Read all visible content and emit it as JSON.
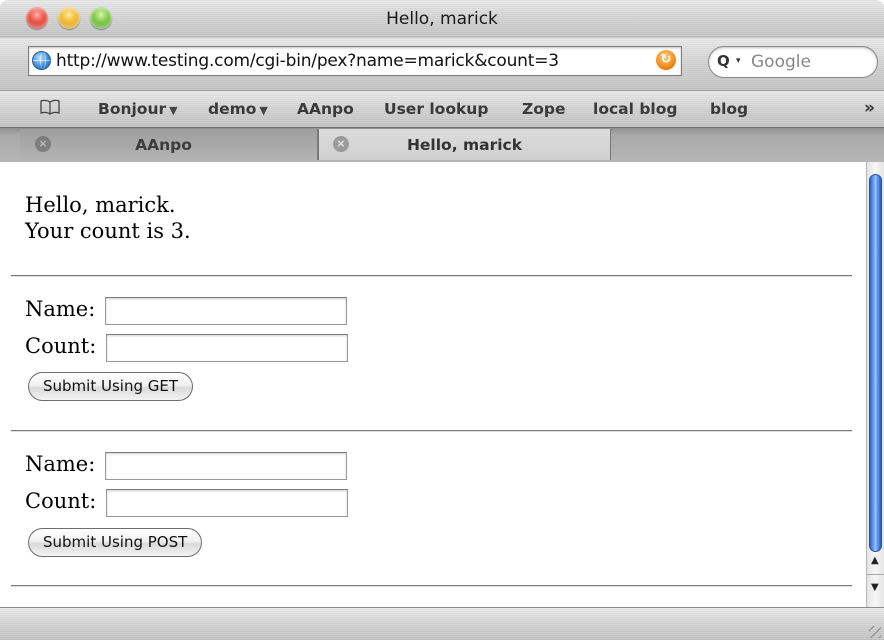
{
  "window": {
    "title": "Hello, marick"
  },
  "address_bar": {
    "url": "http://www.testing.com/cgi-bin/pex?name=marick&count=3",
    "search_placeholder": "Google"
  },
  "bookmarks": [
    {
      "label": "Bonjour",
      "has_menu": true
    },
    {
      "label": "demo",
      "has_menu": true
    },
    {
      "label": "AAnpo",
      "has_menu": false
    },
    {
      "label": "User lookup",
      "has_menu": false
    },
    {
      "label": "Zope",
      "has_menu": false
    },
    {
      "label": "local blog",
      "has_menu": false
    },
    {
      "label": "blog",
      "has_menu": false
    }
  ],
  "tabs": [
    {
      "label": "AAnpo",
      "active": false
    },
    {
      "label": "Hello, marick",
      "active": true
    }
  ],
  "page": {
    "greeting": "Hello, marick.",
    "count_line": "Your count is 3.",
    "get_form": {
      "name_label": "Name:",
      "count_label": "Count:",
      "name_value": "",
      "count_value": "",
      "submit_label": "Submit Using GET"
    },
    "post_form": {
      "name_label": "Name:",
      "count_label": "Count:",
      "name_value": "",
      "count_value": "",
      "submit_label": "Submit Using POST"
    }
  },
  "icons": {
    "site_icon": "globe-icon",
    "reload": "reload-icon",
    "search": "magnifier-icon",
    "bookmarks": "open-book-icon",
    "more": "double-chevron-right-icon",
    "tab_close": "close-icon",
    "accent_color": "#3e8de0"
  }
}
